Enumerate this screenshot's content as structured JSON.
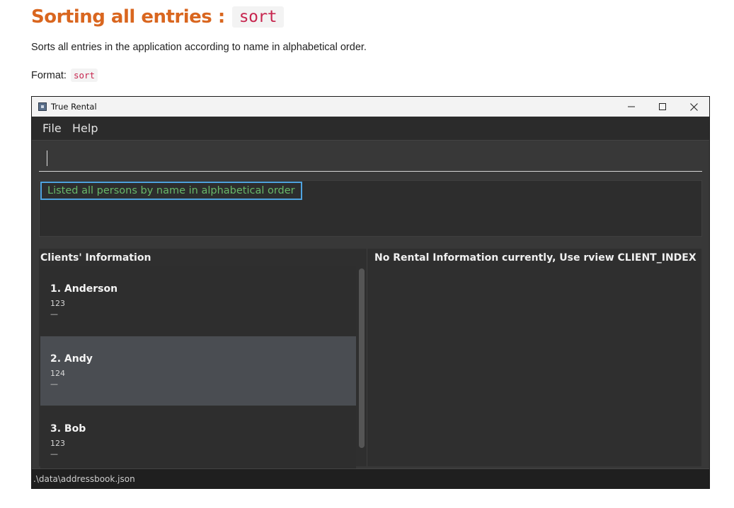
{
  "doc": {
    "heading": "Sorting all entries :",
    "heading_code": "sort",
    "description": "Sorts all entries in the application according to name in alphabetical order.",
    "format_label": "Format:",
    "format_code": "sort"
  },
  "window": {
    "title": "True Rental",
    "icons": {
      "app": "app-icon",
      "minimize": "minimize-icon",
      "maximize": "maximize-icon",
      "close": "close-icon"
    }
  },
  "menu": {
    "items": [
      {
        "label": "File"
      },
      {
        "label": "Help"
      }
    ]
  },
  "command_box": {
    "value": "",
    "placeholder": ""
  },
  "result": {
    "message": "Listed all persons by name in alphabetical order"
  },
  "clients": {
    "title": "Clients' Information",
    "items": [
      {
        "name": "1. Anderson",
        "phone": "123",
        "tag": "—"
      },
      {
        "name": "2. Andy",
        "phone": "124",
        "tag": "—"
      },
      {
        "name": "3. Bob",
        "phone": "123",
        "tag": "—"
      }
    ]
  },
  "rental": {
    "title": "No Rental Information currently, Use rview CLIENT_INDEX"
  },
  "status": {
    "file_path": ".\\data\\addressbook.json"
  },
  "colors": {
    "heading": "#d9661f",
    "code": "#c7254e",
    "result_text": "#67b86a",
    "result_highlight": "#4fa3e0",
    "selected_card": "#4a4d52",
    "window_bg": "#383838"
  }
}
